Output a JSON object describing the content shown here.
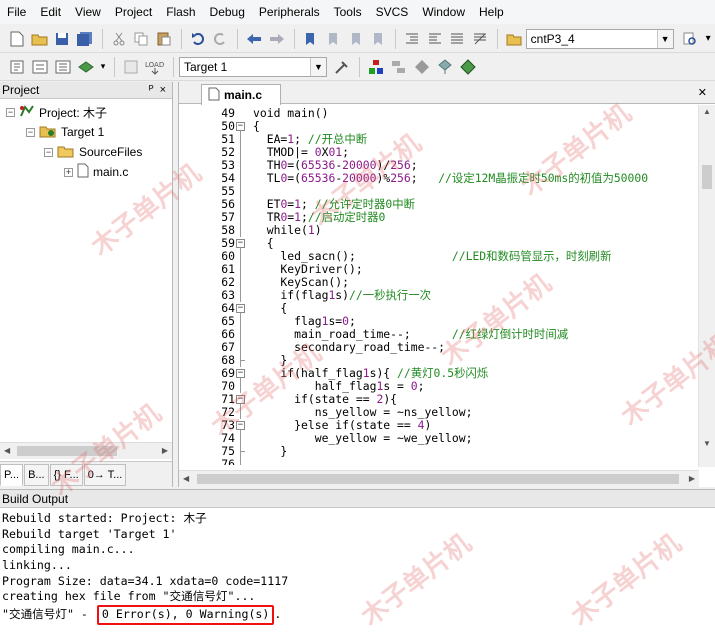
{
  "menu": [
    "File",
    "Edit",
    "View",
    "Project",
    "Flash",
    "Debug",
    "Peripherals",
    "Tools",
    "SVCS",
    "Window",
    "Help"
  ],
  "toolbar": {
    "project_combo": "cntP3_4",
    "target_combo": "Target 1",
    "load_label": "LOAD"
  },
  "project_panel": {
    "title": "Project",
    "pin": "ᴾ",
    "close": "×",
    "project_label": "Project: 木子",
    "target_label": "Target 1",
    "group_label": "SourceFiles",
    "file_label": "main.c",
    "tabs": [
      "P...",
      "B...",
      "{} F...",
      "0→ T..."
    ]
  },
  "editor": {
    "tab_label": "main.c",
    "lines": [
      {
        "num": "49",
        "fold": "",
        "text": "void main()"
      },
      {
        "num": "50",
        "fold": "minus",
        "text": "{"
      },
      {
        "num": "51",
        "fold": "line",
        "text": "  EA=1; ",
        "comment": "//开总中断"
      },
      {
        "num": "52",
        "fold": "line",
        "text": "  TMOD|= 0X01;"
      },
      {
        "num": "53",
        "fold": "line",
        "text": "  TH0=(65536-20000)/256;"
      },
      {
        "num": "54",
        "fold": "line",
        "text": "  TL0=(65536-20000)%256;   ",
        "comment": "//设定12M晶振定时50ms的初值为50000"
      },
      {
        "num": "55",
        "fold": "line",
        "text": ""
      },
      {
        "num": "56",
        "fold": "line",
        "text": "  ET0=1; ",
        "comment": "//允许定时器0中断"
      },
      {
        "num": "57",
        "fold": "line",
        "text": "  TR0=1;",
        "comment": "//启动定时器0"
      },
      {
        "num": "58",
        "fold": "line",
        "text": "  while(1)"
      },
      {
        "num": "59",
        "fold": "minus",
        "text": "  {"
      },
      {
        "num": "60",
        "fold": "line",
        "text": "    led_sacn();              ",
        "comment": "//LED和数码管显示，时刻刷新"
      },
      {
        "num": "61",
        "fold": "line",
        "text": "    KeyDriver();"
      },
      {
        "num": "62",
        "fold": "line",
        "text": "    KeyScan();"
      },
      {
        "num": "63",
        "fold": "line",
        "text": "    if(flag1s)",
        "comment": "//一秒执行一次"
      },
      {
        "num": "64",
        "fold": "minus",
        "text": "    {"
      },
      {
        "num": "65",
        "fold": "line",
        "text": "      flag1s=0;"
      },
      {
        "num": "66",
        "fold": "line",
        "text": "      main_road_time--;      ",
        "comment": "//红绿灯倒计时时间减"
      },
      {
        "num": "67",
        "fold": "line",
        "text": "      secondary_road_time--;"
      },
      {
        "num": "68",
        "fold": "end",
        "text": "    }"
      },
      {
        "num": "69",
        "fold": "minus",
        "text": "    if(half_flag1s){ ",
        "comment": "//黄灯0.5秒闪烁"
      },
      {
        "num": "70",
        "fold": "line",
        "text": "         half_flag1s = 0;"
      },
      {
        "num": "71",
        "fold": "minus",
        "text": "      if(state == 2){"
      },
      {
        "num": "72",
        "fold": "line",
        "text": "         ns_yellow = ~ns_yellow;"
      },
      {
        "num": "73",
        "fold": "minus",
        "text": "      }else if(state == 4)"
      },
      {
        "num": "74",
        "fold": "line",
        "text": "         we_yellow = ~we_yellow;"
      },
      {
        "num": "75",
        "fold": "end",
        "text": "    }"
      },
      {
        "num": "76",
        "fold": "line",
        "text": ""
      }
    ]
  },
  "build_output": {
    "title": "Build Output",
    "lines": [
      "Rebuild started: Project: 木子",
      "Rebuild target 'Target 1'",
      "compiling main.c...",
      "linking...",
      "Program Size: data=34.1 xdata=0 code=1117",
      "creating hex file from \"交通信号灯\"..."
    ],
    "last_prefix": "\"交通信号灯\" - ",
    "last_highlight": "0 Error(s), 0 Warning(s)",
    "last_suffix": "."
  },
  "watermark": "木子单片机",
  "colors": {
    "comment": "#228b22",
    "number": "#8b1a8b",
    "highlight_box": "#ee1111"
  }
}
